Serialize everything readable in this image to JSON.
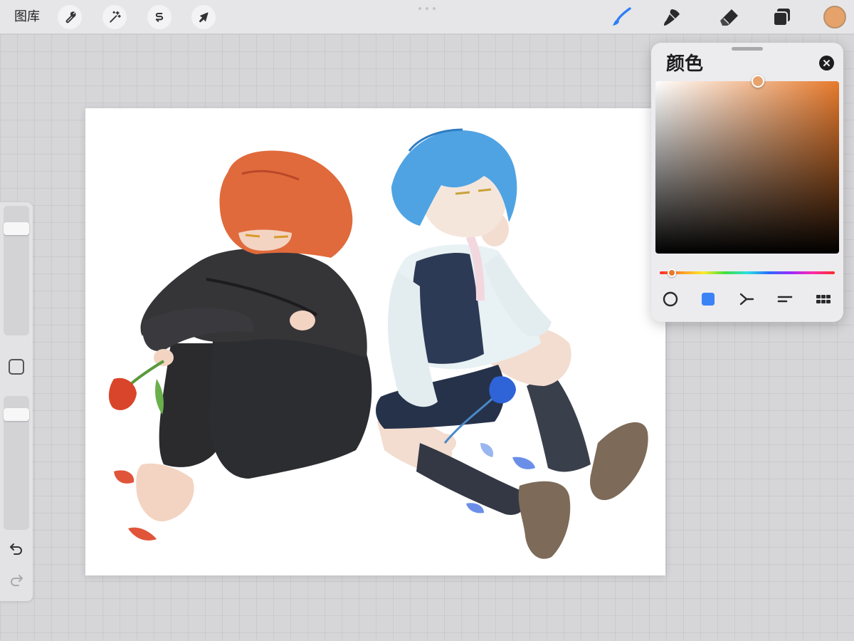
{
  "toolbar": {
    "gallery_label": "图库",
    "left_tools": [
      {
        "icon": "wrench-icon",
        "name": "actions"
      },
      {
        "icon": "magic-wand-icon",
        "name": "adjustments"
      },
      {
        "icon": "selection-s-icon",
        "name": "selection"
      },
      {
        "icon": "arrow-cursor-icon",
        "name": "transform"
      }
    ],
    "right_tools": [
      {
        "icon": "brush-icon",
        "name": "paint",
        "active": true,
        "color": "#2f7ef6"
      },
      {
        "icon": "smudge-icon",
        "name": "smudge"
      },
      {
        "icon": "eraser-icon",
        "name": "erase"
      },
      {
        "icon": "layers-icon",
        "name": "layers"
      }
    ],
    "current_color": "#e6a26b"
  },
  "sidebar": {
    "brush_size_level": 0.86,
    "opacity_level": 0.9,
    "modify_button_icon": "square-icon",
    "undo_icon": "undo-icon",
    "redo_icon": "redo-icon"
  },
  "color_panel": {
    "title": "颜色",
    "close_icon": "close-icon",
    "hue_color": "#e77a2c",
    "selected_color": "#e8a36c",
    "saturation": 0.56,
    "brightness": 1.0,
    "hue_level": 0.07,
    "modes": [
      {
        "icon": "disc-icon",
        "name": "disc"
      },
      {
        "icon": "classic-square-icon",
        "name": "classic",
        "active": true,
        "color": "#3b82f6"
      },
      {
        "icon": "harmony-icon",
        "name": "harmony"
      },
      {
        "icon": "value-icon",
        "name": "value"
      },
      {
        "icon": "palette-grid-icon",
        "name": "palettes"
      }
    ]
  },
  "canvas": {
    "artwork": "illustration-two-seated-characters"
  }
}
